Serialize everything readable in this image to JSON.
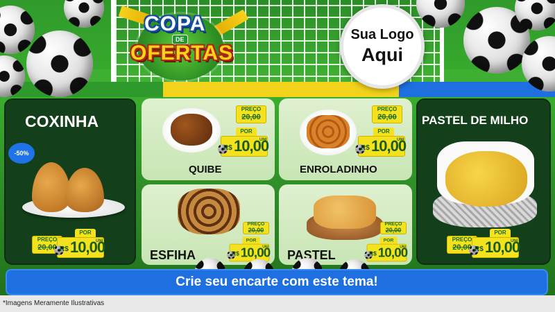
{
  "header": {
    "brand_line1": "COPA",
    "brand_line2": "DE",
    "brand_line3": "OFERTAS",
    "logo_placeholder_line1": "Sua Logo",
    "logo_placeholder_line2": "Aqui"
  },
  "products": [
    {
      "id": "coxinha",
      "name": "COXINHA",
      "discount": "-50%",
      "price_label": "PREÇO",
      "old_price": "20,00",
      "por_label": "POR",
      "currency": "R$",
      "price": "10,00",
      "unit": "UNI"
    },
    {
      "id": "quibe",
      "name": "QUIBE",
      "price_label": "PREÇO",
      "old_price": "20,00",
      "por_label": "POR",
      "currency": "R$",
      "price": "10,00",
      "unit": "UNI"
    },
    {
      "id": "enroladinho",
      "name": "ENROLADINHO",
      "price_label": "PREÇO",
      "old_price": "20,00",
      "por_label": "POR",
      "currency": "R$",
      "price": "10,00",
      "unit": "UNI"
    },
    {
      "id": "esfiha",
      "name": "ESFIHA",
      "price_label": "PREÇO",
      "old_price": "20,00",
      "por_label": "POR",
      "currency": "R$",
      "price": "10,00",
      "unit": "UNI"
    },
    {
      "id": "pastel",
      "name": "PASTEL",
      "price_label": "PREÇO",
      "old_price": "20,00",
      "por_label": "POR",
      "currency": "R$",
      "price": "10,00",
      "unit": "UNI"
    },
    {
      "id": "pastel-de-milho",
      "name": "PASTEL DE MILHO",
      "price_label": "PREÇO",
      "old_price": "20,00",
      "por_label": "POR",
      "currency": "R$",
      "price": "10,00",
      "unit": "UNI"
    }
  ],
  "cta": {
    "label": "Crie seu encarte com este tema!"
  },
  "footer": {
    "note": "*Imagens Meramente Ilustrativas"
  },
  "colors": {
    "accent_blue": "#1e6fe0",
    "tag_yellow": "#f4e21f",
    "field_green": "#2f9a2a",
    "dark_panel": "#13401a"
  }
}
